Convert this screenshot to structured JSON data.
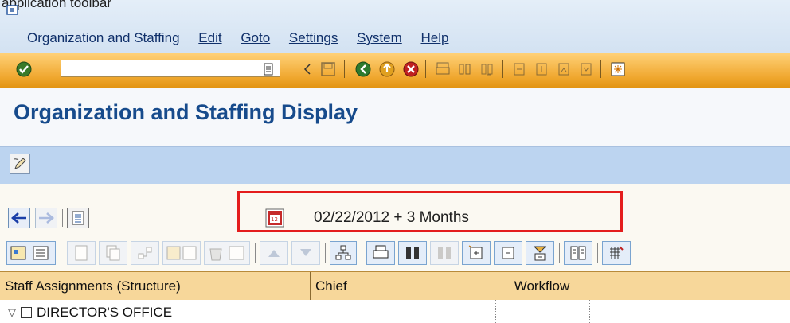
{
  "caption": "application toolbar",
  "menu": {
    "items": [
      "Organization and Staffing",
      "Edit",
      "Goto",
      "Settings",
      "System",
      "Help"
    ]
  },
  "command_field": {
    "value": ""
  },
  "page_title": "Organization and Staffing Display",
  "date_selector": {
    "label": "02/22/2012  + 3 Months"
  },
  "columns": [
    "Staff Assignments (Structure)",
    "Chief",
    "Workflow"
  ],
  "tree": {
    "root_label": "DIRECTOR'S OFFICE"
  },
  "colors": {
    "system_toolbar": "#f0a830",
    "app_toolbar": "#bcd4f0",
    "title": "#174b8c",
    "highlight": "#e41d1d",
    "column_header": "#f7d79a"
  }
}
